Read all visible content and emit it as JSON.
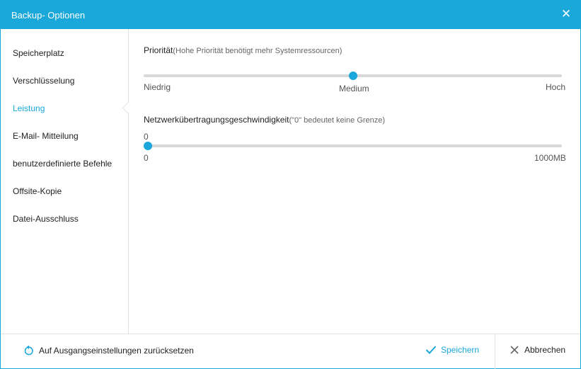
{
  "window": {
    "title": "Backup- Optionen"
  },
  "sidebar": {
    "items": [
      {
        "label": "Speicherplatz",
        "active": false
      },
      {
        "label": "Verschlüsselung",
        "active": false
      },
      {
        "label": "Leistung",
        "active": true
      },
      {
        "label": "E-Mail- Mitteilung",
        "active": false
      },
      {
        "label": "benutzerdefinierte Befehle",
        "active": false
      },
      {
        "label": "Offsite-Kopie",
        "active": false
      },
      {
        "label": "Datei-Ausschluss",
        "active": false
      }
    ]
  },
  "priority": {
    "label": "Priorität",
    "hint": "(Hohe Priorität benötigt mehr Systemressourcen)",
    "min_label": "Niedrig",
    "mid_label": "Medium",
    "max_label": "Hoch",
    "value_fraction": 0.5
  },
  "network": {
    "label": "Netzwerkübertragungsgeschwindigkeit",
    "hint": "(\"0\" bedeutet keine Grenze)",
    "current_value": "0",
    "min_label": "0",
    "max_label": "1000MB",
    "value_fraction": 0.0
  },
  "footer": {
    "reset_label": "Auf Ausgangseinstellungen zurücksetzen",
    "save_label": "Speichern",
    "cancel_label": "Abbrechen"
  },
  "colors": {
    "accent": "#1aa7d9",
    "track": "#d8d8d8"
  }
}
